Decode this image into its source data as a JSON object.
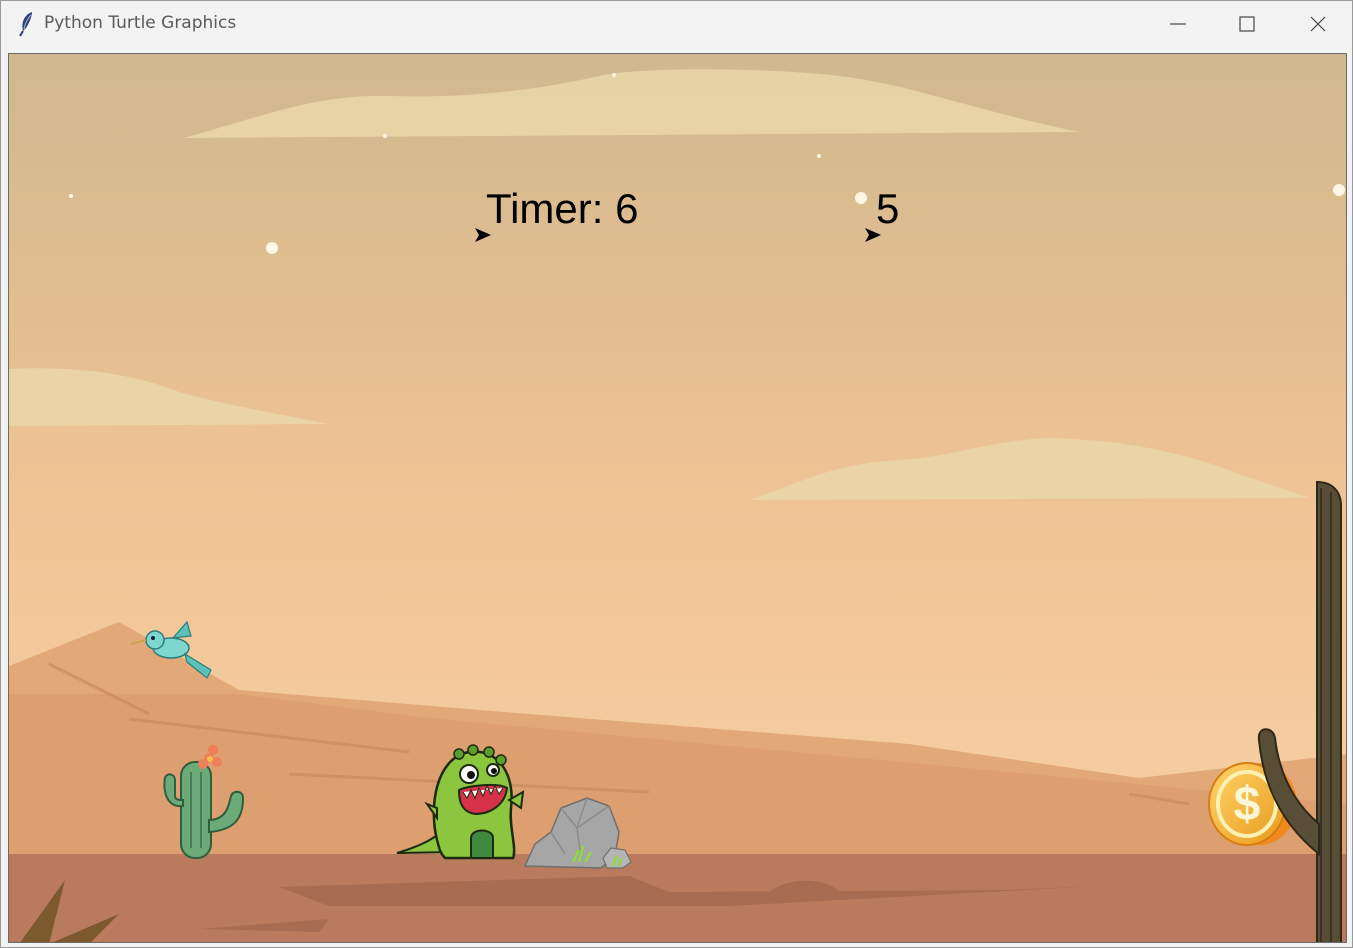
{
  "window": {
    "title": "Python Turtle Graphics",
    "icon": "feather-icon",
    "controls": [
      "minimize-icon",
      "maximize-icon",
      "close-icon"
    ]
  },
  "hud": {
    "timer_text": "Timer: 6",
    "score_text": "5"
  },
  "scene": {
    "sprites": [
      "bird",
      "cactus",
      "dinosaur",
      "rock",
      "coin",
      "tall-cactus"
    ],
    "colors": {
      "sky_top": "#cfb98e",
      "sky_bottom": "#f3cca0",
      "dune": "#dfa172",
      "ground": "#b97a5e"
    }
  }
}
